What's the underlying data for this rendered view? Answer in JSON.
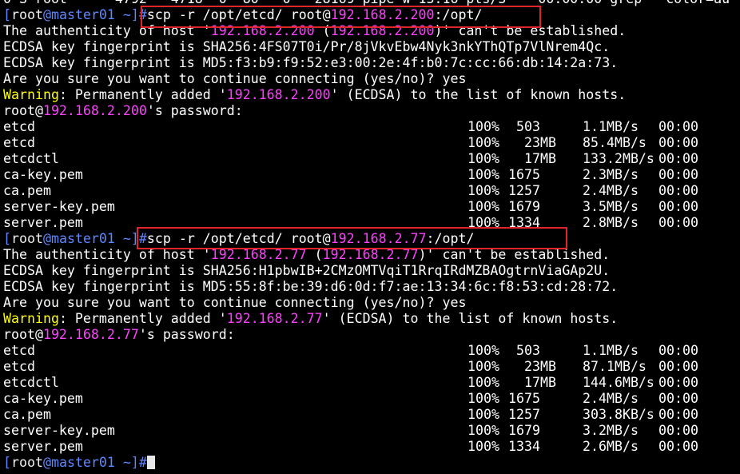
{
  "terminal": {
    "partial_top": "0 S root      4792   4718  0  80   0 - 28169 pipe_w 13:16 pts/3    00:00:00 grep --color=au",
    "prompt_open": "[",
    "prompt_user": "root",
    "prompt_at": "@",
    "prompt_host": "master01",
    "prompt_close": " ~]#",
    "colors": {
      "prompt": "#5f87ff",
      "ip": "#ff40ff",
      "warning": "#ffff00",
      "text": "#ffffff",
      "highlight": "#e0242a"
    },
    "sessions": [
      {
        "cmd_before": "scp -r /opt/etcd/ root@",
        "cmd_ip": "192.168.2.200",
        "cmd_after": ":/opt/",
        "auth_1": "The authenticity of host '",
        "auth_ip1": "192.168.2.200",
        "auth_2": " (",
        "auth_ip2": "192.168.2.200",
        "auth_3": ")' can't be established.",
        "sha": "ECDSA key fingerprint is SHA256:4FS07T0i/Pr/8jVkvEbw4Nyk3nkYThQTp7VlNrem4Qc.",
        "md5": "ECDSA key fingerprint is MD5:f3:b9:f9:52:e3:00:2e:4f:b0:7c:cc:66:db:14:2a:73.",
        "confirm": "Are you sure you want to continue connecting (yes/no)? yes",
        "warn_label": "Warning",
        "warn_1": ": Permanently added '",
        "warn_ip": "192.168.2.200",
        "warn_2": "' (ECDSA) to the list of known hosts.",
        "pw_1": "root@",
        "pw_ip": "192.168.2.200",
        "pw_2": "'s password:",
        "files": [
          {
            "name": "etcd",
            "pct": "100%",
            "size": " 503",
            "rate": "1.1MB/s",
            "time": "00:00"
          },
          {
            "name": "etcd",
            "pct": "100%",
            "size": "  23MB",
            "rate": "85.4MB/s",
            "time": "00:00"
          },
          {
            "name": "etcdctl",
            "pct": "100%",
            "size": "  17MB",
            "rate": "133.2MB/s",
            "time": "00:00"
          },
          {
            "name": "ca-key.pem",
            "pct": "100%",
            "size": "1675",
            "rate": "2.3MB/s",
            "time": "00:00"
          },
          {
            "name": "ca.pem",
            "pct": "100%",
            "size": "1257",
            "rate": "2.4MB/s",
            "time": "00:00"
          },
          {
            "name": "server-key.pem",
            "pct": "100%",
            "size": "1679",
            "rate": "3.5MB/s",
            "time": "00:00"
          },
          {
            "name": "server.pem",
            "pct": "100%",
            "size": "1334",
            "rate": "2.8MB/s",
            "time": "00:00"
          }
        ]
      },
      {
        "cmd_before": "scp -r /opt/etcd/ root@",
        "cmd_ip": "192.168.2.77",
        "cmd_after": ":/opt/",
        "auth_1": "The authenticity of host '",
        "auth_ip1": "192.168.2.77",
        "auth_2": " (",
        "auth_ip2": "192.168.2.77",
        "auth_3": ")' can't be established.",
        "sha": "ECDSA key fingerprint is SHA256:H1pbwIB+2CMzOMTVqiT1RrqIRdMZBAOgtrnViaGAp2U.",
        "md5": "ECDSA key fingerprint is MD5:55:8f:be:39:d6:0d:f7:ae:13:34:6c:f8:53:cd:28:72.",
        "confirm": "Are you sure you want to continue connecting (yes/no)? yes",
        "warn_label": "Warning",
        "warn_1": ": Permanently added '",
        "warn_ip": "192.168.2.77",
        "warn_2": "' (ECDSA) to the list of known hosts.",
        "pw_1": "root@",
        "pw_ip": "192.168.2.77",
        "pw_2": "'s password:",
        "files": [
          {
            "name": "etcd",
            "pct": "100%",
            "size": " 503",
            "rate": "1.1MB/s",
            "time": "00:00"
          },
          {
            "name": "etcd",
            "pct": "100%",
            "size": "  23MB",
            "rate": "87.1MB/s",
            "time": "00:00"
          },
          {
            "name": "etcdctl",
            "pct": "100%",
            "size": "  17MB",
            "rate": "144.6MB/s",
            "time": "00:00"
          },
          {
            "name": "ca-key.pem",
            "pct": "100%",
            "size": "1675",
            "rate": "2.4MB/s",
            "time": "00:00"
          },
          {
            "name": "ca.pem",
            "pct": "100%",
            "size": "1257",
            "rate": "303.8KB/s",
            "time": "00:00"
          },
          {
            "name": "server-key.pem",
            "pct": "100%",
            "size": "1679",
            "rate": "3.2MB/s",
            "time": "00:00"
          },
          {
            "name": "server.pem",
            "pct": "100%",
            "size": "1334",
            "rate": "2.6MB/s",
            "time": "00:00"
          }
        ]
      }
    ]
  }
}
